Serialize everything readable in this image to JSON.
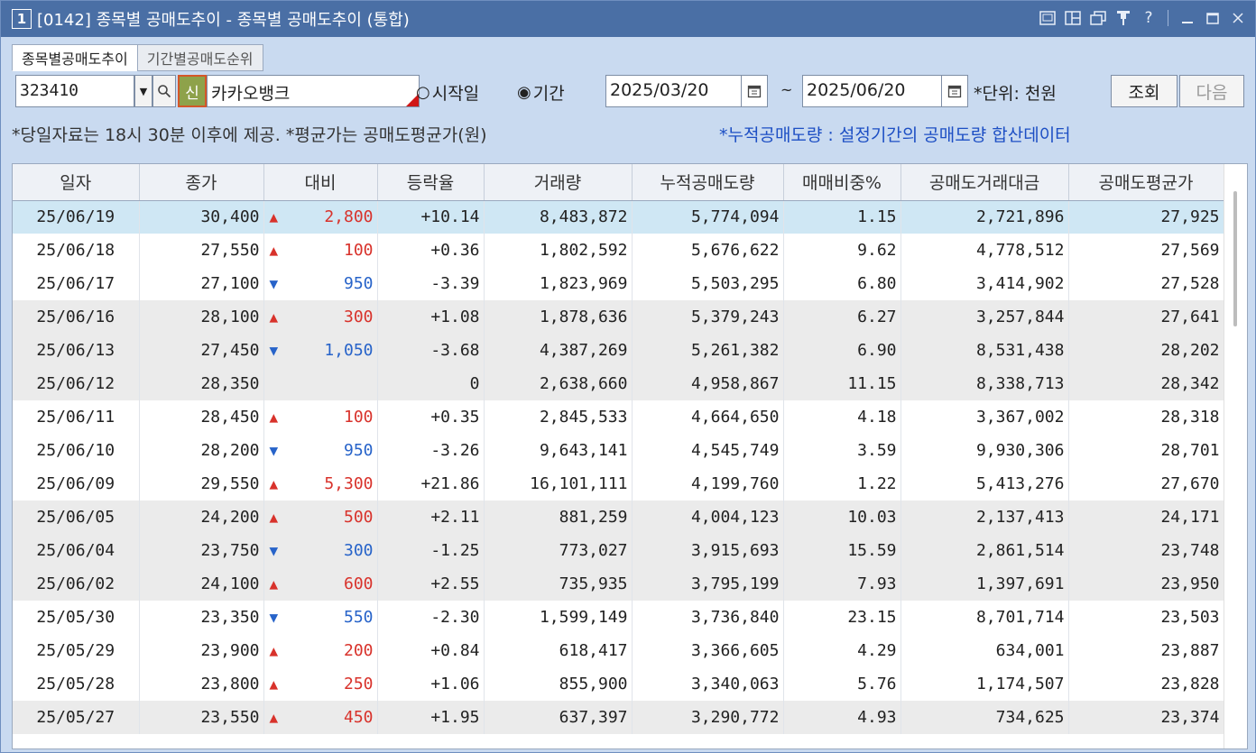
{
  "window": {
    "number": "1",
    "title": "[0142] 종목별 공매도추이 - 종목별 공매도추이 (통합)"
  },
  "tabs": [
    {
      "label": "종목별공매도추이",
      "active": true
    },
    {
      "label": "기간별공매도순위",
      "active": false
    }
  ],
  "toolbar": {
    "code": "323410",
    "new_badge": "신",
    "name": "카카오뱅크",
    "radio_start": "시작일",
    "radio_period": "기간",
    "start_date": "2025/03/20",
    "tilde": "~",
    "end_date": "2025/06/20",
    "unit": "*단위: 천원",
    "query_label": "조회",
    "next_label": "다음"
  },
  "info": {
    "left": "*당일자료는 18시 30분 이후에 제공. *평균가는 공매도평균가(원)",
    "right": "*누적공매도량 : 설정기간의 공매도량 합산데이터"
  },
  "table": {
    "headers": [
      "일자",
      "종가",
      "대비",
      "등락율",
      "거래량",
      "누적공매도량",
      "매매비중%",
      "공매도거래대금",
      "공매도평균가"
    ],
    "rows": [
      {
        "date": "25/06/19",
        "close": "30,400",
        "dir": "up",
        "diff": "2,800",
        "rate": "+10.14",
        "volume": "8,483,872",
        "cum_short": "5,774,094",
        "ratio": "1.15",
        "short_amount": "2,721,896",
        "avg": "27,925"
      },
      {
        "date": "25/06/18",
        "close": "27,550",
        "dir": "up",
        "diff": "100",
        "rate": "+0.36",
        "volume": "1,802,592",
        "cum_short": "5,676,622",
        "ratio": "9.62",
        "short_amount": "4,778,512",
        "avg": "27,569"
      },
      {
        "date": "25/06/17",
        "close": "27,100",
        "dir": "down",
        "diff": "950",
        "rate": "-3.39",
        "volume": "1,823,969",
        "cum_short": "5,503,295",
        "ratio": "6.80",
        "short_amount": "3,414,902",
        "avg": "27,528"
      },
      {
        "date": "25/06/16",
        "close": "28,100",
        "dir": "up",
        "diff": "300",
        "rate": "+1.08",
        "volume": "1,878,636",
        "cum_short": "5,379,243",
        "ratio": "6.27",
        "short_amount": "3,257,844",
        "avg": "27,641"
      },
      {
        "date": "25/06/13",
        "close": "27,450",
        "dir": "down",
        "diff": "1,050",
        "rate": "-3.68",
        "volume": "4,387,269",
        "cum_short": "5,261,382",
        "ratio": "6.90",
        "short_amount": "8,531,438",
        "avg": "28,202"
      },
      {
        "date": "25/06/12",
        "close": "28,350",
        "dir": "flat",
        "diff": "",
        "rate": "0",
        "volume": "2,638,660",
        "cum_short": "4,958,867",
        "ratio": "11.15",
        "short_amount": "8,338,713",
        "avg": "28,342"
      },
      {
        "date": "25/06/11",
        "close": "28,450",
        "dir": "up",
        "diff": "100",
        "rate": "+0.35",
        "volume": "2,845,533",
        "cum_short": "4,664,650",
        "ratio": "4.18",
        "short_amount": "3,367,002",
        "avg": "28,318"
      },
      {
        "date": "25/06/10",
        "close": "28,200",
        "dir": "down",
        "diff": "950",
        "rate": "-3.26",
        "volume": "9,643,141",
        "cum_short": "4,545,749",
        "ratio": "3.59",
        "short_amount": "9,930,306",
        "avg": "28,701"
      },
      {
        "date": "25/06/09",
        "close": "29,550",
        "dir": "up",
        "diff": "5,300",
        "rate": "+21.86",
        "volume": "16,101,111",
        "cum_short": "4,199,760",
        "ratio": "1.22",
        "short_amount": "5,413,276",
        "avg": "27,670"
      },
      {
        "date": "25/06/05",
        "close": "24,200",
        "dir": "up",
        "diff": "500",
        "rate": "+2.11",
        "volume": "881,259",
        "cum_short": "4,004,123",
        "ratio": "10.03",
        "short_amount": "2,137,413",
        "avg": "24,171"
      },
      {
        "date": "25/06/04",
        "close": "23,750",
        "dir": "down",
        "diff": "300",
        "rate": "-1.25",
        "volume": "773,027",
        "cum_short": "3,915,693",
        "ratio": "15.59",
        "short_amount": "2,861,514",
        "avg": "23,748"
      },
      {
        "date": "25/06/02",
        "close": "24,100",
        "dir": "up",
        "diff": "600",
        "rate": "+2.55",
        "volume": "735,935",
        "cum_short": "3,795,199",
        "ratio": "7.93",
        "short_amount": "1,397,691",
        "avg": "23,950"
      },
      {
        "date": "25/05/30",
        "close": "23,350",
        "dir": "down",
        "diff": "550",
        "rate": "-2.30",
        "volume": "1,599,149",
        "cum_short": "3,736,840",
        "ratio": "23.15",
        "short_amount": "8,701,714",
        "avg": "23,503"
      },
      {
        "date": "25/05/29",
        "close": "23,900",
        "dir": "up",
        "diff": "200",
        "rate": "+0.84",
        "volume": "618,417",
        "cum_short": "3,366,605",
        "ratio": "4.29",
        "short_amount": "634,001",
        "avg": "23,887"
      },
      {
        "date": "25/05/28",
        "close": "23,800",
        "dir": "up",
        "diff": "250",
        "rate": "+1.06",
        "volume": "855,900",
        "cum_short": "3,340,063",
        "ratio": "5.76",
        "short_amount": "1,174,507",
        "avg": "23,828"
      },
      {
        "date": "25/05/27",
        "close": "23,550",
        "dir": "up",
        "diff": "450",
        "rate": "+1.95",
        "volume": "637,397",
        "cum_short": "3,290,772",
        "ratio": "4.93",
        "short_amount": "734,625",
        "avg": "23,374"
      }
    ]
  },
  "colors": {
    "up": "#d8322b",
    "down": "#2763c9",
    "title_bar": "#4a6fa5",
    "selected_row": "#cfe7f4"
  }
}
